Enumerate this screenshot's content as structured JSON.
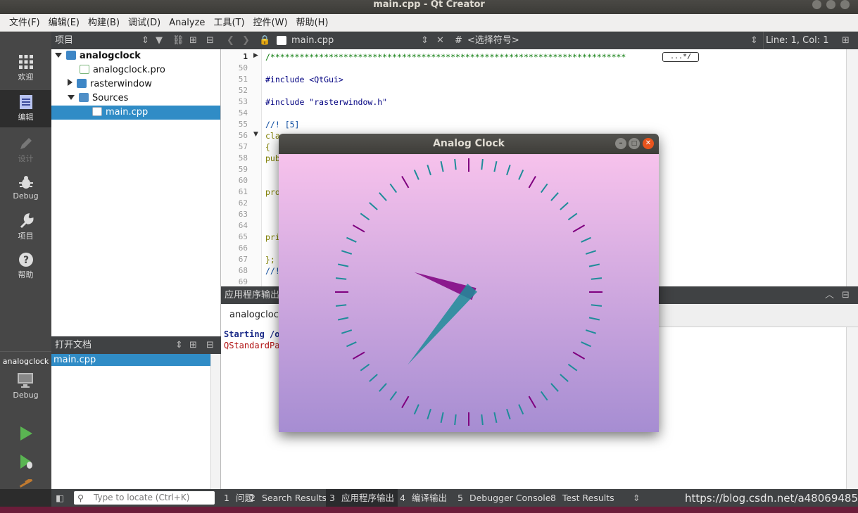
{
  "window": {
    "title": "main.cpp - Qt Creator"
  },
  "menu": [
    "文件(F)",
    "编辑(E)",
    "构建(B)",
    "调试(D)",
    "Analyze",
    "工具(T)",
    "控件(W)",
    "帮助(H)"
  ],
  "modes": [
    {
      "label": "欢迎",
      "icon": "grid-icon"
    },
    {
      "label": "编辑",
      "icon": "document-icon"
    },
    {
      "label": "设计",
      "icon": "pencil-icon"
    },
    {
      "label": "Debug",
      "icon": "bug-icon"
    },
    {
      "label": "项目",
      "icon": "wrench-icon"
    },
    {
      "label": "帮助",
      "icon": "help-icon"
    }
  ],
  "kit": {
    "project": "analogclock",
    "config": "Debug"
  },
  "project_pane": {
    "header": "项目",
    "tree": [
      {
        "label": "analogclock",
        "bold": true
      },
      {
        "label": "analogclock.pro"
      },
      {
        "label": "rasterwindow"
      },
      {
        "label": "Sources"
      },
      {
        "label": "main.cpp",
        "selected": true
      }
    ]
  },
  "open_docs": {
    "header": "打开文档",
    "items": [
      "main.cpp"
    ]
  },
  "editor": {
    "file": "main.cpp",
    "symbol": "<选择符号>",
    "position": "Line: 1, Col: 1",
    "hash": "#",
    "lines": [
      {
        "n": "1",
        "text": "/*************************************************************************",
        "fold": "...*/"
      },
      {
        "n": "50",
        "text": ""
      },
      {
        "n": "51",
        "text": "#include <QtGui>"
      },
      {
        "n": "52",
        "text": ""
      },
      {
        "n": "53",
        "text": "#include \"rasterwindow.h\""
      },
      {
        "n": "54",
        "text": ""
      },
      {
        "n": "55",
        "text": "//! [5]"
      },
      {
        "n": "56",
        "text": "cla"
      },
      {
        "n": "57",
        "text": "{"
      },
      {
        "n": "58",
        "text": "pub"
      },
      {
        "n": "59",
        "text": ""
      },
      {
        "n": "60",
        "text": ""
      },
      {
        "n": "61",
        "text": "pro"
      },
      {
        "n": "62",
        "text": ""
      },
      {
        "n": "63",
        "text": ""
      },
      {
        "n": "64",
        "text": ""
      },
      {
        "n": "65",
        "text": "pri"
      },
      {
        "n": "66",
        "text": ""
      },
      {
        "n": "67",
        "text": "};"
      },
      {
        "n": "68",
        "text": "//!"
      },
      {
        "n": "69",
        "text": ""
      }
    ]
  },
  "output": {
    "header": "应用程序输出",
    "tab": "analogclock",
    "lines": [
      "Starting /o",
      "QStandardPa"
    ]
  },
  "statusbar": {
    "locate_placeholder": "Type to locate (Ctrl+K)",
    "panes": [
      {
        "num": "1",
        "label": "问题"
      },
      {
        "num": "2",
        "label": "Search Results"
      },
      {
        "num": "3",
        "label": "应用程序输出",
        "active": true
      },
      {
        "num": "4",
        "label": "编译输出"
      },
      {
        "num": "5",
        "label": "Debugger Console"
      },
      {
        "num": "8",
        "label": "Test Results"
      }
    ],
    "watermark": "https://blog.csdn.net/a480694856"
  },
  "clock": {
    "title": "Analog Clock",
    "hour_color": "#7f007f",
    "minute_color": "#1f8c99",
    "hour_hand_angle_deg": -70,
    "minute_hand_angle_deg": -140
  }
}
